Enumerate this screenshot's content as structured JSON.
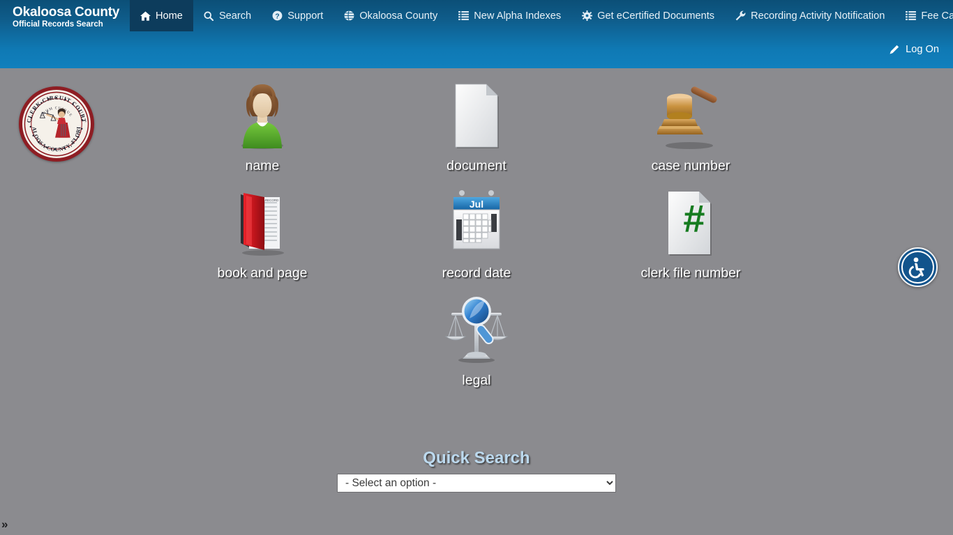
{
  "header": {
    "brand_title": "Okaloosa County",
    "brand_subtitle": "Official Records Search",
    "nav_items": [
      {
        "label": "Home",
        "icon": "home-icon",
        "active": true
      },
      {
        "label": "Search",
        "icon": "search-icon",
        "active": false
      },
      {
        "label": "Support",
        "icon": "question-circle-icon",
        "active": false
      },
      {
        "label": "Okaloosa County",
        "icon": "globe-icon",
        "active": false
      },
      {
        "label": "New Alpha Indexes",
        "icon": "list-icon",
        "active": false
      },
      {
        "label": "Get eCertified Documents",
        "icon": "gear-icon",
        "active": false
      },
      {
        "label": "Recording Activity Notification",
        "icon": "wrench-icon",
        "active": false
      },
      {
        "label": "Fee Calculator",
        "icon": "list-icon",
        "active": false
      }
    ],
    "logon_label": "Log On",
    "logon_icon": "pencil-icon"
  },
  "seal": {
    "outer_text_top": "CLERK CIRCUIT COURT",
    "motto": "SUUM CUIQUE",
    "outer_text_bottom": "OKALOOSA COUNTY, FLORIDA"
  },
  "search_tiles": [
    {
      "label": "name",
      "icon": "person-icon"
    },
    {
      "label": "document",
      "icon": "document-icon"
    },
    {
      "label": "case number",
      "icon": "gavel-icon"
    },
    {
      "label": "book and page",
      "icon": "book-icon"
    },
    {
      "label": "record date",
      "icon": "calendar-icon"
    },
    {
      "label": "clerk file number",
      "icon": "hash-document-icon"
    },
    {
      "label": "legal",
      "icon": "scales-magnifier-icon"
    }
  ],
  "calendar_month": "Jul",
  "quick_search": {
    "title": "Quick Search",
    "selected_option": "- Select an option -",
    "options": [
      "- Select an option -"
    ]
  },
  "accessibility": {
    "label": "accessibility-widget",
    "icon": "wheelchair-icon"
  },
  "footer": {
    "expand_chevron": "»"
  },
  "colors": {
    "nav_top": "#0b4f77",
    "nav_bottom": "#1180bd",
    "nav_active": "#0d3c5c",
    "page_bg": "#8b8b8f",
    "quick_title": "#bcd9ee",
    "seal_border": "#8e1d23",
    "a11y_bg": "#12548c"
  }
}
